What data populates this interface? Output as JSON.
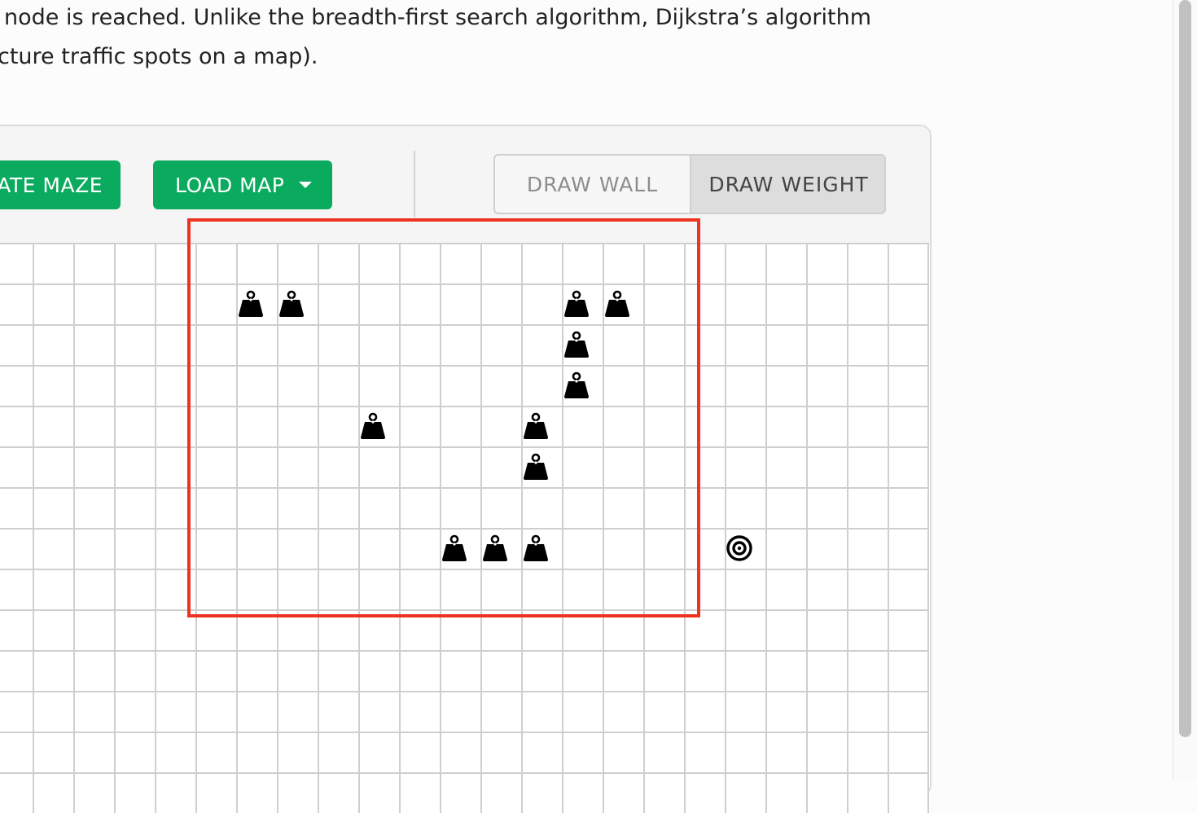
{
  "intro": {
    "line1": "node is reached. Unlike the breadth-first search algorithm, Dijkstra’s algorithm",
    "line2": "cture traffic spots on a map)."
  },
  "toolbar": {
    "maze_label": "ATE MAZE",
    "load_map_label": "LOAD MAP",
    "draw_wall_label": "DRAW WALL",
    "draw_weight_label": "DRAW WEIGHT",
    "selected_mode": "DRAW WEIGHT"
  },
  "grid": {
    "weights": [
      {
        "col": 6,
        "row": 1
      },
      {
        "col": 7,
        "row": 1
      },
      {
        "col": 14,
        "row": 1
      },
      {
        "col": 15,
        "row": 1
      },
      {
        "col": 14,
        "row": 2
      },
      {
        "col": 14,
        "row": 3
      },
      {
        "col": 9,
        "row": 4
      },
      {
        "col": 13,
        "row": 4
      },
      {
        "col": 13,
        "row": 5
      },
      {
        "col": 11,
        "row": 7
      },
      {
        "col": 12,
        "row": 7
      },
      {
        "col": 13,
        "row": 7
      }
    ],
    "target": {
      "col": 18,
      "row": 7
    }
  },
  "colors": {
    "accent_green": "#0aab5e",
    "highlight_red": "#ee3322"
  },
  "icons": {
    "weight": "weight-icon",
    "target": "target-icon",
    "dropdown": "caret-down-icon"
  }
}
